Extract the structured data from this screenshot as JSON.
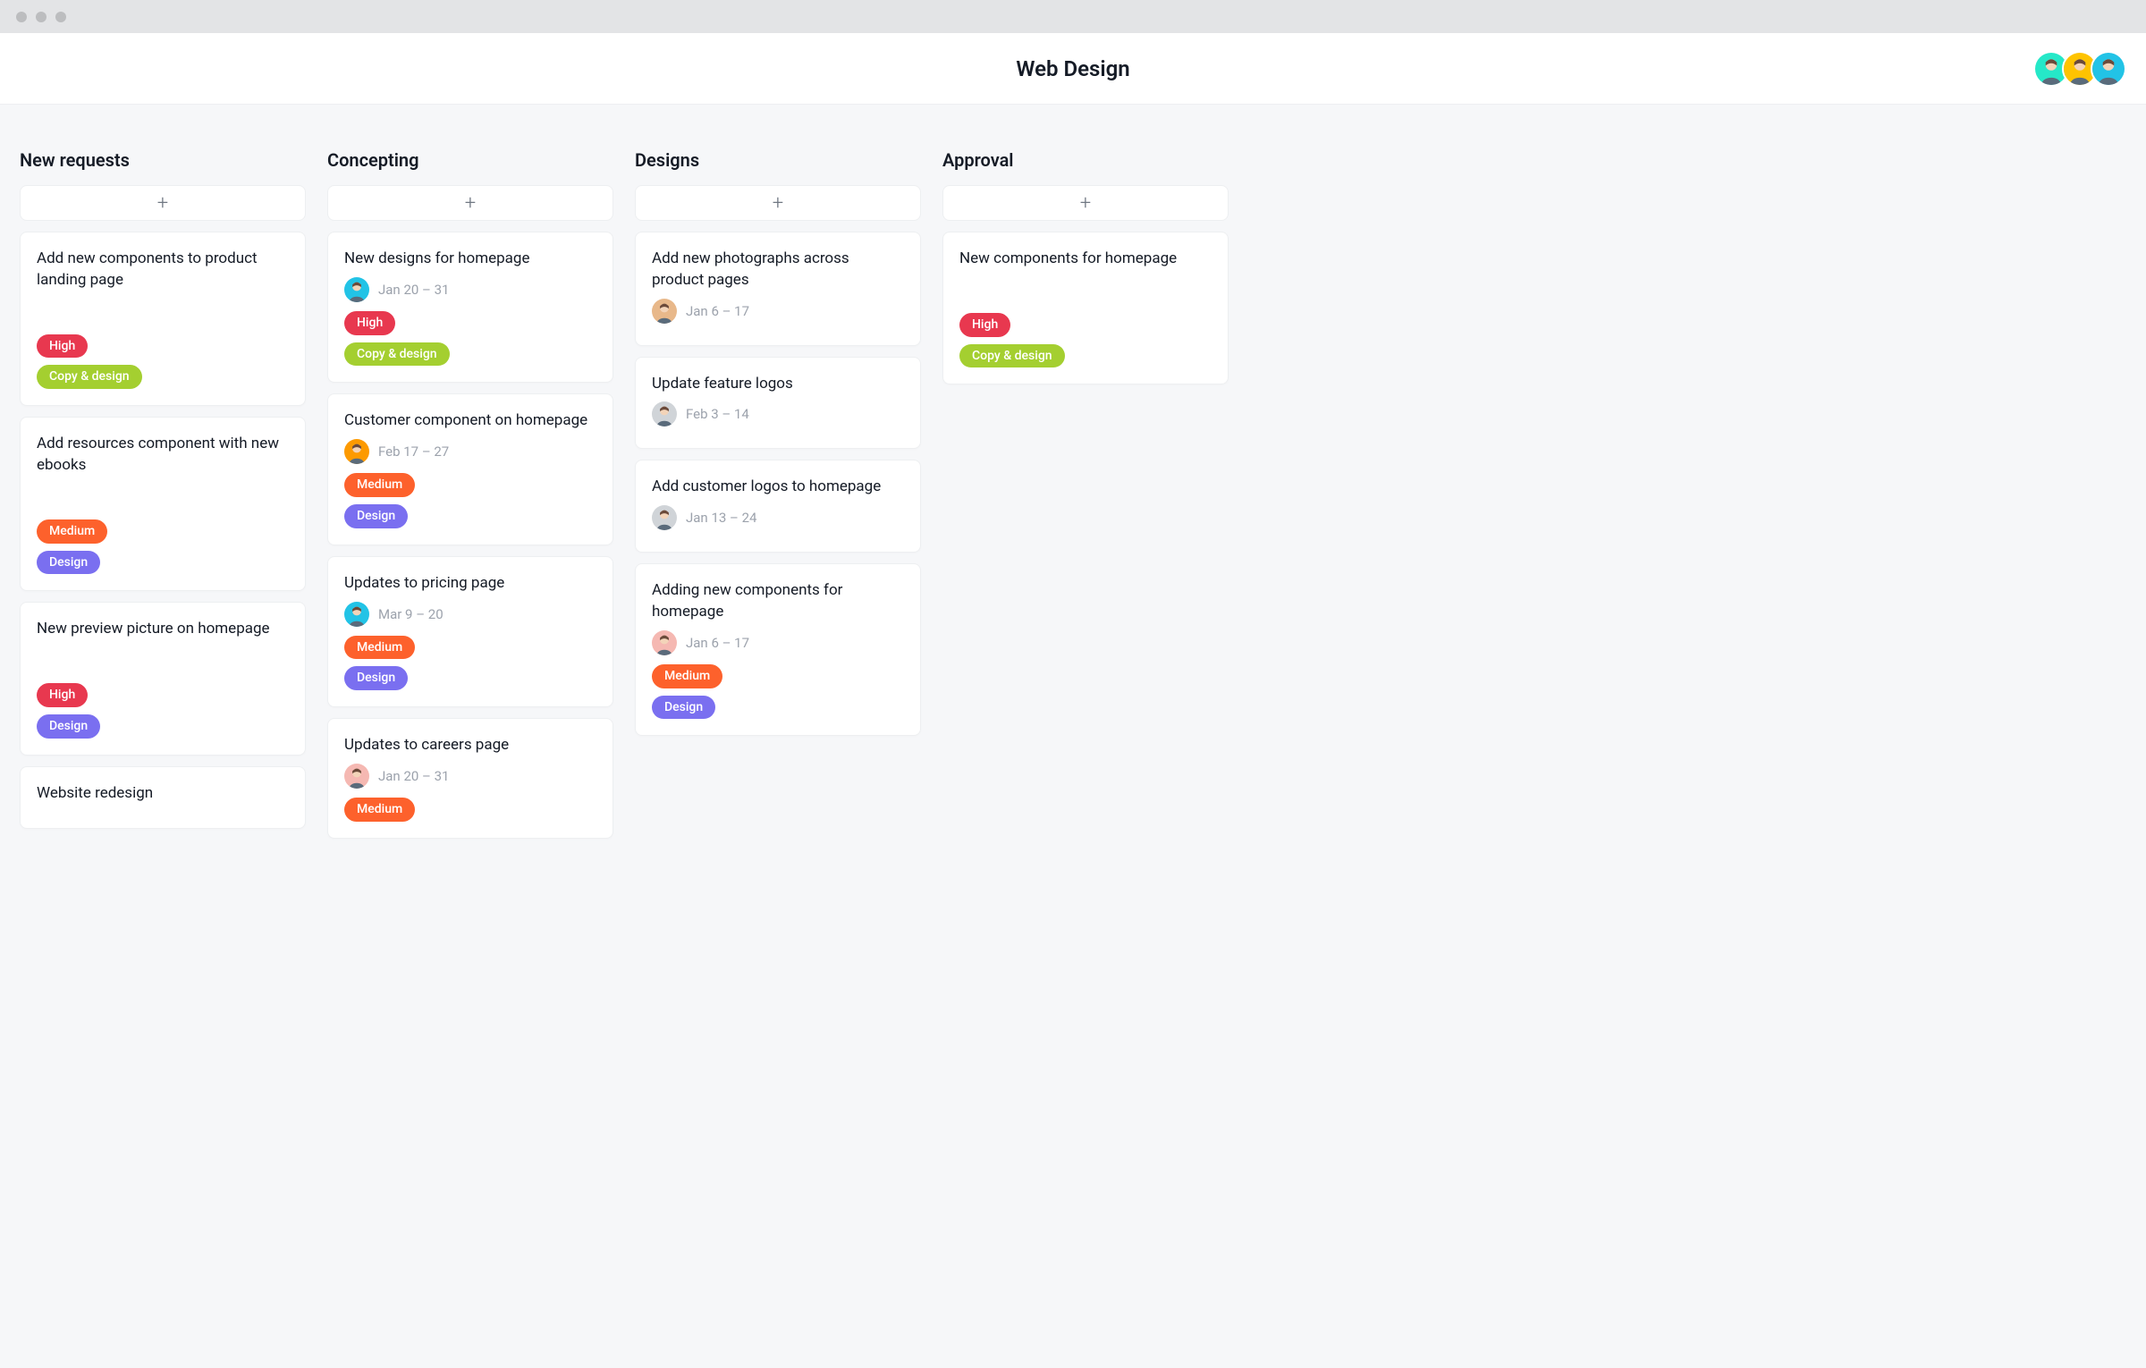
{
  "header": {
    "title": "Web Design"
  },
  "tag_colors": {
    "High": "#e8384f",
    "Medium": "#fd612c",
    "Copy & design": "#a4cf30",
    "Design": "#7a6ff0"
  },
  "avatar_colors": [
    "#25e8c8",
    "#fec300",
    "#22c3e6"
  ],
  "mini_avatar_colors": {
    "teal": "#22c3e6",
    "orange": "#fd9a00",
    "pink": "#f5b8b2",
    "gray": "#d0d4d8",
    "tan": "#e8b88a"
  },
  "columns": [
    {
      "title": "New requests",
      "cards": [
        {
          "title": "Add new components to product landing page",
          "spacer": true,
          "tags": [
            "High",
            "Copy & design"
          ]
        },
        {
          "title": "Add resources component with new ebooks",
          "spacer": true,
          "tags": [
            "Medium",
            "Design"
          ]
        },
        {
          "title": "New preview picture on homepage",
          "spacer": true,
          "tags": [
            "High",
            "Design"
          ]
        },
        {
          "title": "Website redesign"
        }
      ]
    },
    {
      "title": "Concepting",
      "cards": [
        {
          "title": "New designs for homepage",
          "avatar": "teal",
          "date": "Jan 20 – 31",
          "tags": [
            "High",
            "Copy & design"
          ]
        },
        {
          "title": "Customer component on homepage",
          "avatar": "orange",
          "date": "Feb 17 – 27",
          "tags": [
            "Medium",
            "Design"
          ]
        },
        {
          "title": "Updates to pricing page",
          "avatar": "teal",
          "date": "Mar 9 – 20",
          "tags": [
            "Medium",
            "Design"
          ]
        },
        {
          "title": "Updates to careers page",
          "avatar": "pink",
          "date": "Jan 20 – 31",
          "tags": [
            "Medium"
          ]
        }
      ]
    },
    {
      "title": "Designs",
      "cards": [
        {
          "title": "Add new photographs across product pages",
          "avatar": "tan",
          "date": "Jan 6 – 17"
        },
        {
          "title": "Update feature logos",
          "avatar": "gray",
          "date": "Feb 3 – 14"
        },
        {
          "title": "Add customer logos to homepage",
          "avatar": "gray",
          "date": "Jan 13 – 24"
        },
        {
          "title": "Adding new components for homepage",
          "avatar": "pink",
          "date": "Jan 6 – 17",
          "tags": [
            "Medium",
            "Design"
          ]
        }
      ]
    },
    {
      "title": "Approval",
      "cards": [
        {
          "title": "New components for homepage",
          "spacer": true,
          "tags": [
            "High",
            "Copy & design"
          ]
        }
      ]
    }
  ]
}
